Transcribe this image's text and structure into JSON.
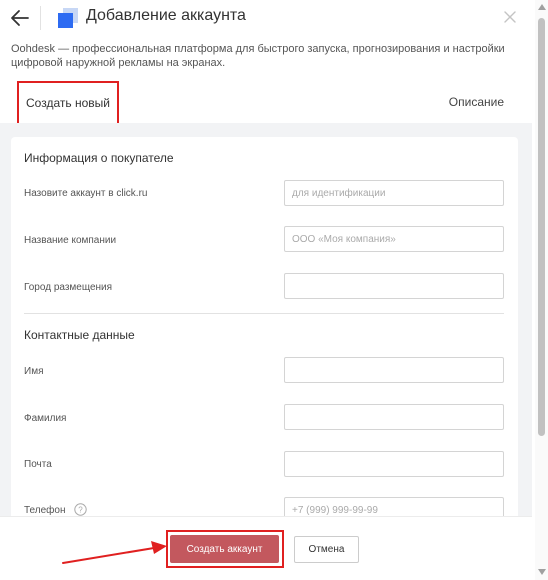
{
  "header": {
    "title": "Добавление аккаунта"
  },
  "description": "Oohdesk — профессиональная платформа для быстрого запуска, прогнозирования и настройки цифровой наружной рекламы на экранах.",
  "tabs": {
    "create_new": "Создать новый",
    "description": "Описание"
  },
  "buyer_section": {
    "title": "Информация о покупателе",
    "fields": {
      "account_name": {
        "label": "Назовите аккаунт в click.ru",
        "placeholder": "для идентификации",
        "value": ""
      },
      "company_name": {
        "label": "Название компании",
        "placeholder": "ООО «Моя компания»",
        "value": ""
      },
      "city": {
        "label": "Город размещения",
        "placeholder": "",
        "value": ""
      }
    }
  },
  "contact_section": {
    "title": "Контактные данные",
    "fields": {
      "first_name": {
        "label": "Имя",
        "placeholder": "",
        "value": ""
      },
      "last_name": {
        "label": "Фамилия",
        "placeholder": "",
        "value": ""
      },
      "email": {
        "label": "Почта",
        "placeholder": "",
        "value": ""
      },
      "phone": {
        "label": "Телефон",
        "placeholder": "+7 (999) 999-99-99",
        "value": ""
      }
    }
  },
  "footer": {
    "submit_label": "Создать аккаунт",
    "cancel_label": "Отмена"
  },
  "colors": {
    "accent_logo": "#2d6bf2",
    "submit_button": "#c3585e",
    "annotation_red": "#e02020",
    "content_bg": "#f2f3f5"
  },
  "icons": {
    "back": "arrow-left-icon",
    "logo": "squares-logo-icon",
    "close": "close-icon",
    "help": "question-circle-icon",
    "annotation": "red-arrow-icon"
  }
}
